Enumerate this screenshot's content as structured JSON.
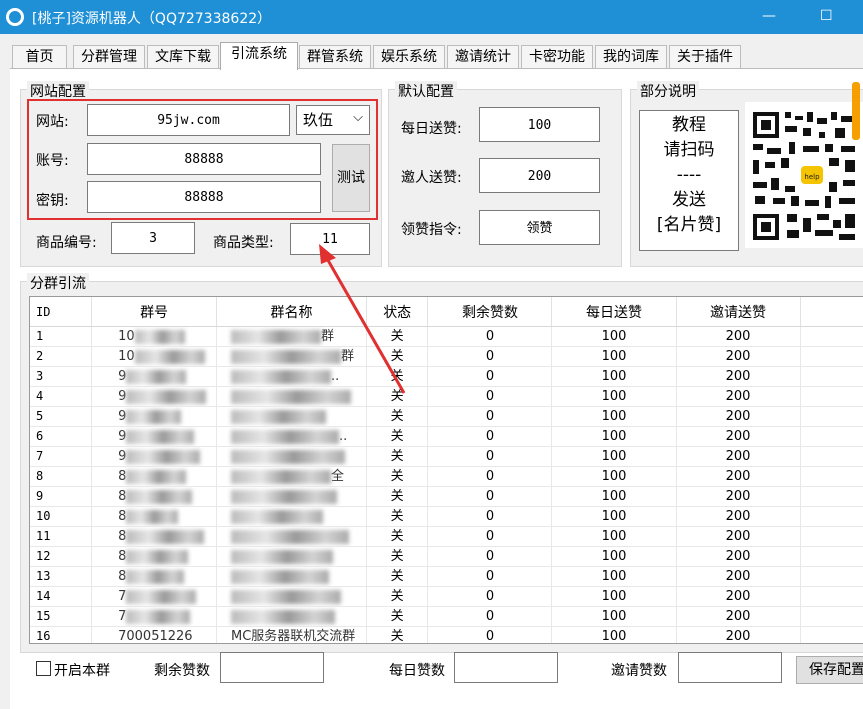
{
  "window": {
    "title": "[桃子]资源机器人（QQ727338622）",
    "min": "—",
    "max": "☐"
  },
  "tabs": [
    "首页",
    "分群管理",
    "文库下载",
    "引流系统",
    "群管系统",
    "娱乐系统",
    "邀请统计",
    "卡密功能",
    "我的词库",
    "关于插件"
  ],
  "site_config": {
    "legend": "网站配置",
    "site_label": "网站:",
    "site_value": "95jw.com",
    "site_combo": "玖伍",
    "account_label": "账号:",
    "account_value": "88888",
    "key_label": "密钥:",
    "key_value": "88888",
    "test_button": "测试",
    "product_id_label": "商品编号:",
    "product_id_value": "3",
    "product_type_label": "商品类型:",
    "product_type_value": "11"
  },
  "default_config": {
    "legend": "默认配置",
    "daily_label": "每日送赞:",
    "daily_value": "100",
    "invite_label": "邀人送赞:",
    "invite_value": "200",
    "claim_label": "领赞指令:",
    "claim_value": "领赞"
  },
  "notes": {
    "legend": "部分说明",
    "lines": [
      "教程",
      "请扫码",
      "----",
      "发送",
      "[名片赞]"
    ],
    "qr_badge": "help"
  },
  "group_flow": {
    "legend": "分群引流",
    "columns": [
      "ID",
      "群号",
      "群名称",
      "状态",
      "剩余赞数",
      "每日送赞",
      "邀请送赞"
    ],
    "rows": [
      {
        "id": "1",
        "num": "10",
        "name": "群",
        "status": "关",
        "remain": "0",
        "daily": "100",
        "invite": "200"
      },
      {
        "id": "2",
        "num": "10",
        "name": "群",
        "status": "关",
        "remain": "0",
        "daily": "100",
        "invite": "200"
      },
      {
        "id": "3",
        "num": "9",
        "name": "..",
        "status": "关",
        "remain": "0",
        "daily": "100",
        "invite": "200"
      },
      {
        "id": "4",
        "num": "9",
        "name": "",
        "status": "关",
        "remain": "0",
        "daily": "100",
        "invite": "200"
      },
      {
        "id": "5",
        "num": "9",
        "name": "",
        "status": "关",
        "remain": "0",
        "daily": "100",
        "invite": "200"
      },
      {
        "id": "6",
        "num": "9",
        "name": "..",
        "status": "关",
        "remain": "0",
        "daily": "100",
        "invite": "200"
      },
      {
        "id": "7",
        "num": "9",
        "name": "",
        "status": "关",
        "remain": "0",
        "daily": "100",
        "invite": "200"
      },
      {
        "id": "8",
        "num": "8",
        "name": "全",
        "status": "关",
        "remain": "0",
        "daily": "100",
        "invite": "200"
      },
      {
        "id": "9",
        "num": "8",
        "name": "",
        "status": "关",
        "remain": "0",
        "daily": "100",
        "invite": "200"
      },
      {
        "id": "10",
        "num": "8",
        "name": "",
        "status": "关",
        "remain": "0",
        "daily": "100",
        "invite": "200"
      },
      {
        "id": "11",
        "num": "8",
        "name": "",
        "status": "关",
        "remain": "0",
        "daily": "100",
        "invite": "200"
      },
      {
        "id": "12",
        "num": "8",
        "name": "",
        "status": "关",
        "remain": "0",
        "daily": "100",
        "invite": "200"
      },
      {
        "id": "13",
        "num": "8",
        "name": "",
        "status": "关",
        "remain": "0",
        "daily": "100",
        "invite": "200"
      },
      {
        "id": "14",
        "num": "7",
        "name": "",
        "status": "关",
        "remain": "0",
        "daily": "100",
        "invite": "200"
      },
      {
        "id": "15",
        "num": "7",
        "name": "",
        "status": "关",
        "remain": "0",
        "daily": "100",
        "invite": "200"
      },
      {
        "id": "16",
        "num": "700051226",
        "name": "MC服务器联机交流群",
        "status": "关",
        "remain": "0",
        "daily": "100",
        "invite": "200"
      }
    ]
  },
  "bottom": {
    "enable_label": "开启本群",
    "remain_label": "剩余赞数",
    "daily_label": "每日赞数",
    "invite_label": "邀请赞数",
    "save_button": "保存配置"
  },
  "colors": {
    "titlebar": "#1f8fd6",
    "highlight_box": "#e03030",
    "arrow": "#e03030"
  }
}
